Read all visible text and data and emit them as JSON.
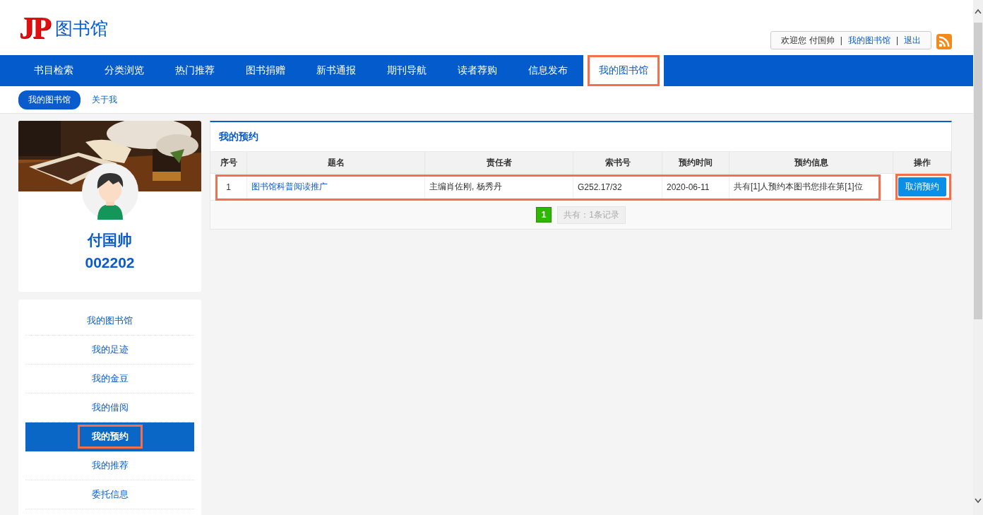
{
  "header": {
    "logo_mark": "JP",
    "logo_text": "图书馆",
    "user_bar": [
      {
        "kind": "text",
        "text": "欢迎您 付国帅"
      },
      {
        "kind": "separator",
        "text": "|"
      },
      {
        "kind": "link",
        "text": "我的图书馆"
      },
      {
        "kind": "separator",
        "text": "|"
      },
      {
        "kind": "link",
        "text": "退出"
      }
    ]
  },
  "nav": {
    "items": [
      {
        "label": "书目检索",
        "selected": false,
        "highlighted": false
      },
      {
        "label": "分类浏览",
        "selected": false,
        "highlighted": false
      },
      {
        "label": "热门推荐",
        "selected": false,
        "highlighted": false
      },
      {
        "label": "图书捐赠",
        "selected": false,
        "highlighted": false
      },
      {
        "label": "新书通报",
        "selected": false,
        "highlighted": false
      },
      {
        "label": "期刊导航",
        "selected": false,
        "highlighted": false
      },
      {
        "label": "读者荐购",
        "selected": false,
        "highlighted": false
      },
      {
        "label": "信息发布",
        "selected": false,
        "highlighted": false
      },
      {
        "label": "我的图书馆",
        "selected": true,
        "highlighted": true
      }
    ]
  },
  "subnav": {
    "items": [
      {
        "label": "我的图书馆",
        "selected": true
      },
      {
        "label": "关于我",
        "selected": false
      }
    ]
  },
  "profile": {
    "name": "付国帅",
    "id": "002202"
  },
  "side_menu": {
    "items": [
      {
        "label": "我的图书馆",
        "selected": false,
        "highlighted": false
      },
      {
        "label": "我的足迹",
        "selected": false,
        "highlighted": false
      },
      {
        "label": "我的金豆",
        "selected": false,
        "highlighted": false
      },
      {
        "label": "我的借阅",
        "selected": false,
        "highlighted": false
      },
      {
        "label": "我的预约",
        "selected": true,
        "highlighted": true
      },
      {
        "label": "我的推荐",
        "selected": false,
        "highlighted": false
      },
      {
        "label": "委托信息",
        "selected": false,
        "highlighted": false
      }
    ]
  },
  "panel": {
    "title": "我的预约",
    "table": {
      "columns": [
        "序号",
        "题名",
        "责任者",
        "索书号",
        "预约时间",
        "预约信息",
        "操作"
      ],
      "rows": [
        {
          "cells": [
            {
              "kind": "text",
              "text": "1"
            },
            {
              "kind": "link",
              "text": "图书馆科普阅读推广"
            },
            {
              "kind": "text",
              "text": "主编肖佐刚, 杨秀丹"
            },
            {
              "kind": "text",
              "text": "G252.17/32"
            },
            {
              "kind": "text",
              "text": "2020-06-11"
            },
            {
              "kind": "text",
              "text": "共有[1]人预约本图书您排在第[1]位"
            }
          ],
          "action": "取消预约",
          "highlighted": true,
          "action_highlighted": true
        }
      ]
    },
    "pagination": {
      "pages": [
        {
          "label": "1",
          "selected": true
        }
      ],
      "summary": "共有：1条记录"
    }
  }
}
